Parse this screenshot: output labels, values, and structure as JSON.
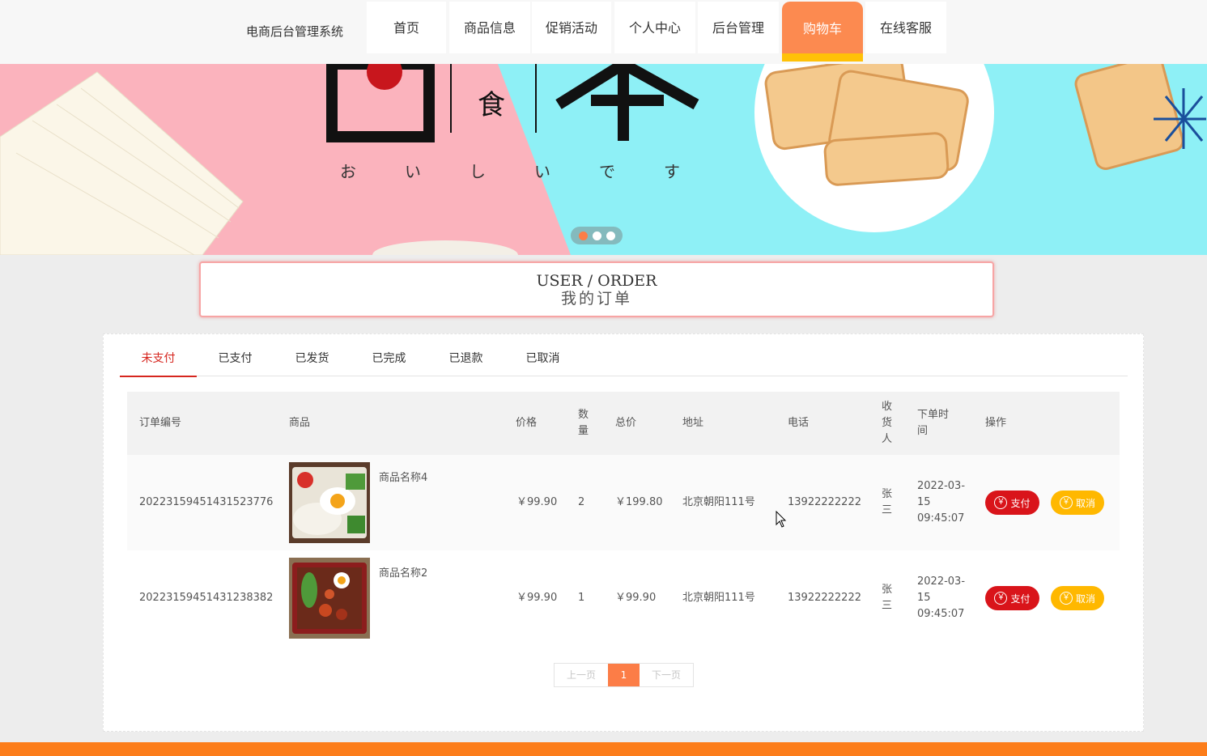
{
  "header": {
    "brand": "电商后台管理系统",
    "nav": [
      {
        "label": "首页"
      },
      {
        "label": "商品信息"
      },
      {
        "label": "促销活动"
      },
      {
        "label": "个人中心"
      },
      {
        "label": "后台管理"
      },
      {
        "label": "购物车",
        "active": true
      },
      {
        "label": "在线客服"
      }
    ]
  },
  "banner": {
    "slides": 3,
    "active_slide": 0
  },
  "title": {
    "en": "USER / ORDER",
    "cn": "我的订单"
  },
  "tabs": [
    {
      "label": "未支付",
      "active": true
    },
    {
      "label": "已支付"
    },
    {
      "label": "已发货"
    },
    {
      "label": "已完成"
    },
    {
      "label": "已退款"
    },
    {
      "label": "已取消"
    }
  ],
  "table": {
    "headers": {
      "order_no": "订单编号",
      "product": "商品",
      "price": "价格",
      "qty": "数量",
      "total": "总价",
      "address": "地址",
      "phone": "电话",
      "receiver": "收货人",
      "time": "下单时间",
      "actions": "操作"
    },
    "rows": [
      {
        "order_no": "20223159451431523776",
        "product_name": "商品名称4",
        "price": "￥99.90",
        "qty": "2",
        "total": "￥199.80",
        "address": "北京朝阳111号",
        "phone": "13922222222",
        "receiver": "张三",
        "time_date": "2022-03-15",
        "time_clock": "09:45:07"
      },
      {
        "order_no": "20223159451431238382",
        "product_name": "商品名称2",
        "price": "￥99.90",
        "qty": "1",
        "total": "￥99.90",
        "address": "北京朝阳111号",
        "phone": "13922222222",
        "receiver": "张三",
        "time_date": "2022-03-15",
        "time_clock": "09:45:07"
      }
    ],
    "pay_label": "支付",
    "cancel_label": "取消",
    "yen_icon": "￥"
  },
  "pager": {
    "prev": "上一页",
    "current": "1",
    "next": "下一页"
  },
  "colors": {
    "accent": "#fc7d47",
    "pay": "#d9141a",
    "cancel": "#ffb800",
    "active_tab": "#d6261f"
  }
}
